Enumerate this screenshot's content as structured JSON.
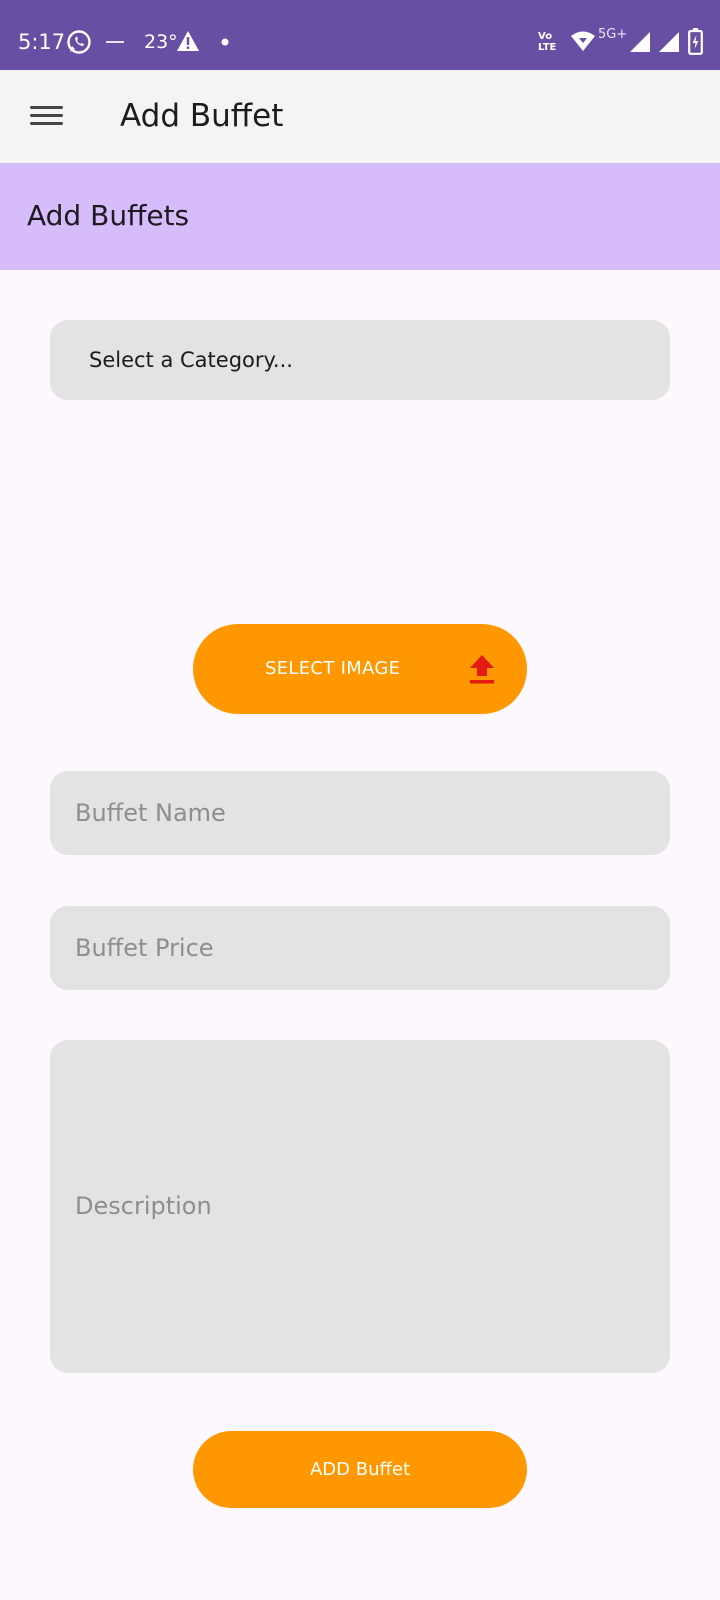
{
  "status_bar": {
    "time": "5:17",
    "temperature": "23°",
    "icons": [
      "whatsapp-icon",
      "notification-icon",
      "warning-icon",
      "dot-icon",
      "volte-icon",
      "wifi-icon",
      "signal-icon",
      "signal-icon",
      "battery-icon"
    ],
    "network_label": "5G+",
    "volte_label_top": "Vo",
    "volte_label_bottom": "LTE"
  },
  "app_bar": {
    "title": "Add Buffet",
    "menu_icon": "hamburger-menu-icon"
  },
  "section": {
    "title": "Add Buffets"
  },
  "form": {
    "category_select": {
      "value": "Select a Category..."
    },
    "select_image_button": {
      "label": "SELECT IMAGE",
      "icon": "upload-icon"
    },
    "buffet_name": {
      "placeholder": "Buffet Name"
    },
    "buffet_price": {
      "placeholder": "Buffet Price"
    },
    "description": {
      "placeholder": "Description"
    },
    "submit_button": {
      "label": "ADD Buffet"
    }
  },
  "colors": {
    "status_bar": "#6750a4",
    "app_bar": "#f4f4f2",
    "section_header": "#d7bcfb",
    "accent_button": "#ff9800",
    "upload_icon": "#e31b12",
    "field_background": "#e3e3e3"
  }
}
